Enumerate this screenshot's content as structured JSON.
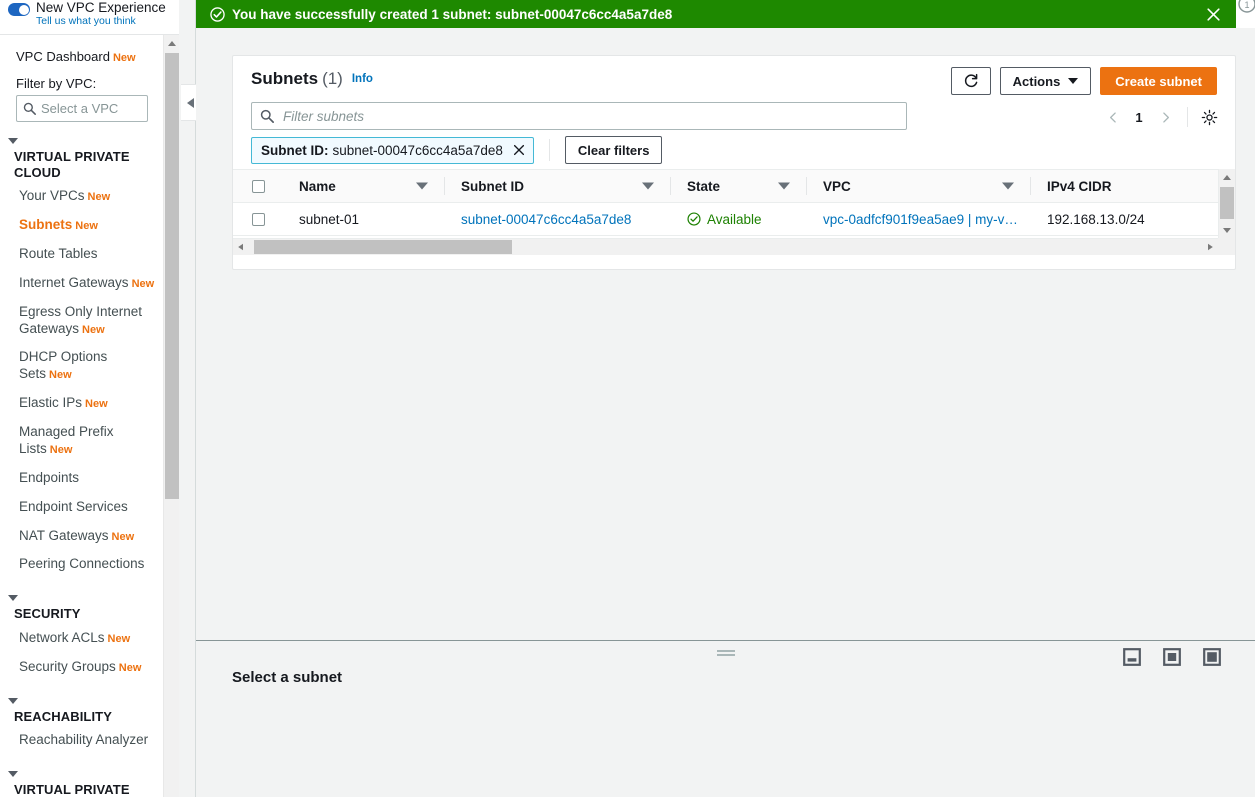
{
  "sidebar": {
    "new_experience": {
      "title": "New VPC Experience",
      "subtitle": "Tell us what you think",
      "toggle_state": "on"
    },
    "dashboard": {
      "label": "VPC Dashboard",
      "badge": "New"
    },
    "filter_label": "Filter by VPC:",
    "vpc_select_placeholder": "Select a VPC",
    "groups": [
      {
        "title": "VIRTUAL PRIVATE CLOUD",
        "items": [
          {
            "label": "Your VPCs",
            "badge": "New",
            "active": false
          },
          {
            "label": "Subnets",
            "badge": "New",
            "active": true
          },
          {
            "label": "Route Tables",
            "badge": "",
            "active": false
          },
          {
            "label": "Internet Gateways",
            "badge": "New",
            "active": false
          },
          {
            "label": "Egress Only Internet Gateways",
            "badge": "New",
            "active": false
          },
          {
            "label": "DHCP Options Sets",
            "badge": "New",
            "active": false
          },
          {
            "label": "Elastic IPs",
            "badge": "New",
            "active": false
          },
          {
            "label": "Managed Prefix Lists",
            "badge": "New",
            "active": false
          },
          {
            "label": "Endpoints",
            "badge": "",
            "active": false
          },
          {
            "label": "Endpoint Services",
            "badge": "",
            "active": false
          },
          {
            "label": "NAT Gateways",
            "badge": "New",
            "active": false
          },
          {
            "label": "Peering Connections",
            "badge": "",
            "active": false
          }
        ]
      },
      {
        "title": "SECURITY",
        "items": [
          {
            "label": "Network ACLs",
            "badge": "New",
            "active": false
          },
          {
            "label": "Security Groups",
            "badge": "New",
            "active": false
          }
        ]
      },
      {
        "title": "REACHABILITY",
        "items": [
          {
            "label": "Reachability Analyzer",
            "badge": "",
            "active": false
          }
        ]
      },
      {
        "title": "VIRTUAL PRIVATE",
        "items": []
      }
    ]
  },
  "flash": {
    "icon": "check-circle-icon",
    "message": "You have successfully created 1 subnet: subnet-00047c6cc4a5a7de8",
    "background_color": "#1e8900",
    "close_label": "Close"
  },
  "panel": {
    "title": "Subnets",
    "count": "(1)",
    "info_label": "Info",
    "refresh_label": "Refresh",
    "actions_label": "Actions",
    "create_label": "Create subnet",
    "create_button_color": "#ec7211"
  },
  "search": {
    "placeholder": "Filter subnets",
    "value": ""
  },
  "filters": {
    "token": {
      "key": "Subnet ID:",
      "value": "subnet-00047c6cc4a5a7de8"
    },
    "clear_label": "Clear filters"
  },
  "pagination": {
    "page": "1",
    "prev_label": "Previous page",
    "next_label": "Next page",
    "settings_label": "Preferences"
  },
  "table": {
    "columns": [
      {
        "label": "Name",
        "sortable": true
      },
      {
        "label": "Subnet ID",
        "sortable": true
      },
      {
        "label": "State",
        "sortable": true
      },
      {
        "label": "VPC",
        "sortable": true
      },
      {
        "label": "IPv4 CIDR",
        "sortable": false
      }
    ],
    "rows": [
      {
        "name": "subnet-01",
        "subnet_id": "subnet-00047c6cc4a5a7de8",
        "state": "Available",
        "state_color": "#1d8102",
        "vpc": "vpc-0adfcf901f9ea5ae9 | my-v…",
        "ipv4_cidr": "192.168.13.0/24"
      }
    ]
  },
  "split_panel": {
    "title": "Select a subnet",
    "layout_icons": [
      "panel-bottom-icon",
      "panel-side-icon",
      "panel-full-icon"
    ]
  }
}
